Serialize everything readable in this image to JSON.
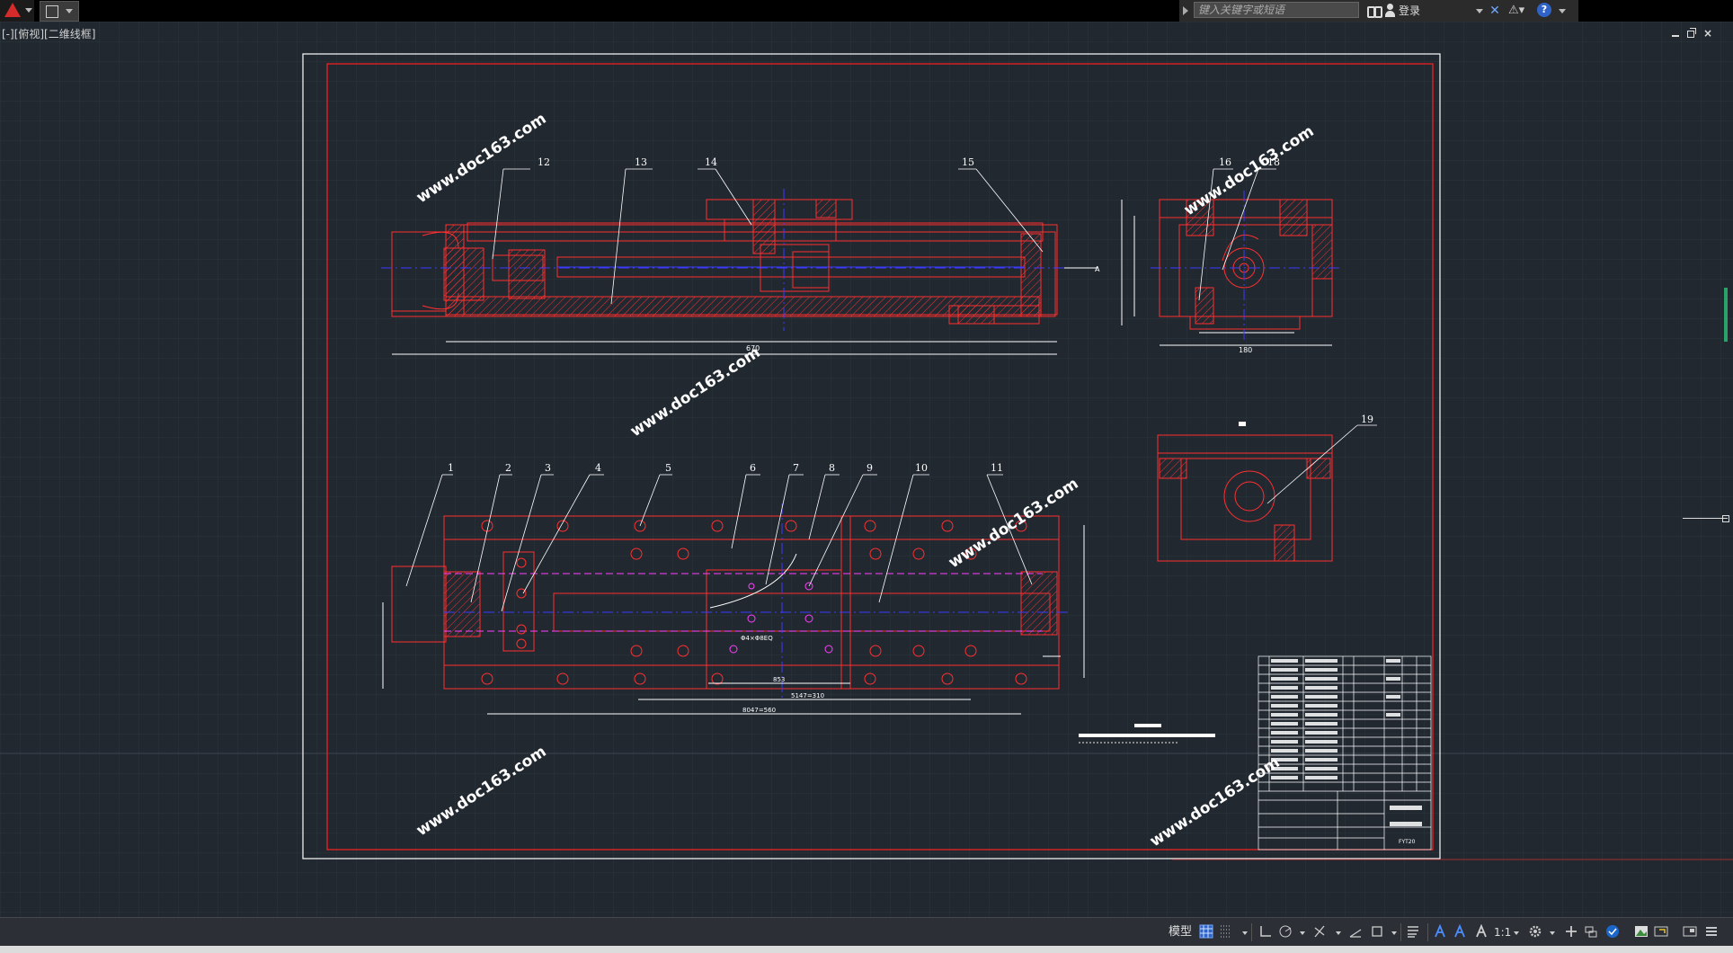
{
  "search": {
    "placeholder": "键入关键字或短语"
  },
  "account": {
    "login_label": "登录"
  },
  "help": {
    "label": "?"
  },
  "viewport": {
    "label": "[-][俯视][二维线框]"
  },
  "window": {
    "min": "",
    "restore": "",
    "close": "×"
  },
  "drawing": {
    "watermark": "www.doc163.com",
    "balloons_top": [
      "12",
      "13",
      "14",
      "15",
      "16",
      "18",
      "19"
    ],
    "balloons_bottom": [
      "1",
      "2",
      "3",
      "4",
      "5",
      "6",
      "7",
      "8",
      "9",
      "10",
      "11"
    ],
    "dim_top_length": "670",
    "dim_top_right": "A",
    "dim_side_width": "180",
    "dim_bottom_1": "853",
    "dim_bottom_2": "5147=310",
    "dim_bottom_3": "8047=560",
    "note_hole": "Φ4×Φ8EQ",
    "title_block_name": "FYT20",
    "colors": {
      "frame_inner": "#ff2020",
      "frame_outer": "#ffffff",
      "part": "#ff3030",
      "center": "#3b3bff",
      "accent": "#ff40ff"
    }
  },
  "statusbar": {
    "model_label": "模型",
    "scale_label": "1:1"
  }
}
